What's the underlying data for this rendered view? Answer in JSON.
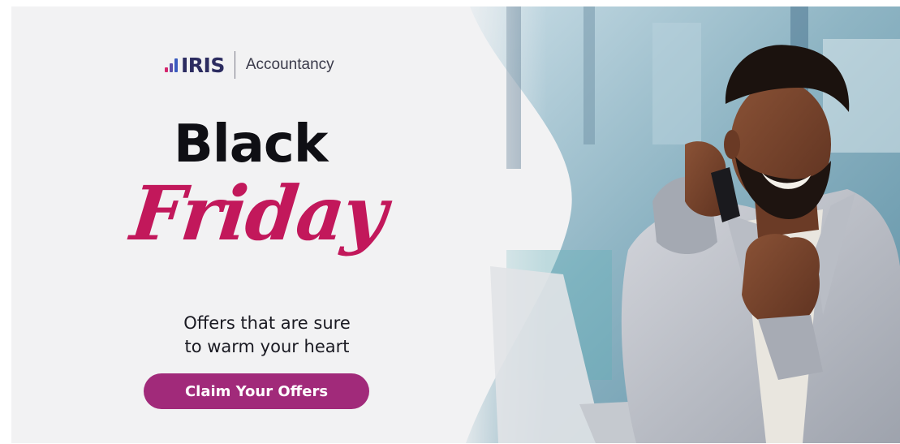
{
  "logo": {
    "brand": "IRIS",
    "product": "Accountancy"
  },
  "headline": {
    "line1": "Black",
    "line2": "Friday"
  },
  "tagline": {
    "line1": "Offers that are sure",
    "line2": "to warm your heart"
  },
  "cta": {
    "label": "Claim Your Offers"
  },
  "colors": {
    "accent": "#c2185b",
    "button": "#a12a7a",
    "brand_navy": "#2c2c60",
    "background": "#f2f2f3"
  },
  "icons": {
    "logo_mark": "bar-chart-logo-icon"
  }
}
